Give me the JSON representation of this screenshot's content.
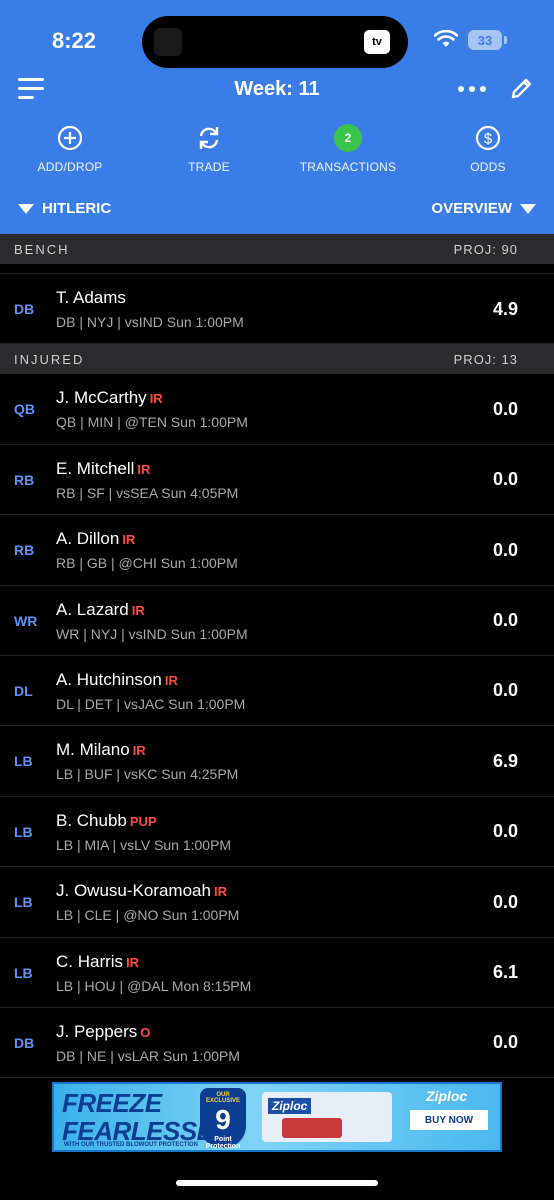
{
  "status": {
    "time": "8:22",
    "battery": "33",
    "island_app": "tv"
  },
  "nav": {
    "title": "Week: 11"
  },
  "actions": [
    {
      "label": "ADD/DROP",
      "icon": "plus-circle-icon"
    },
    {
      "label": "TRADE",
      "icon": "refresh-icon"
    },
    {
      "label": "TRANSACTIONS",
      "badge": "2"
    },
    {
      "label": "ODDS",
      "icon": "dollar-circle-icon"
    }
  ],
  "subnav": {
    "team": "HITLERIC",
    "view": "OVERVIEW"
  },
  "bench": {
    "title": "BENCH",
    "proj": "PROJ: 90",
    "players": [
      {
        "pos": "DB",
        "name": "T. Adams",
        "tag": "",
        "info": "DB | NYJ | vsIND Sun 1:00PM",
        "pts": "4.9"
      }
    ]
  },
  "injured": {
    "title": "INJURED",
    "proj": "PROJ: 13",
    "players": [
      {
        "pos": "QB",
        "name": "J. McCarthy",
        "tag": "IR",
        "info": "QB | MIN | @TEN Sun 1:00PM",
        "pts": "0.0"
      },
      {
        "pos": "RB",
        "name": "E. Mitchell",
        "tag": "IR",
        "info": "RB | SF | vsSEA Sun 4:05PM",
        "pts": "0.0"
      },
      {
        "pos": "RB",
        "name": "A. Dillon",
        "tag": "IR",
        "info": "RB | GB | @CHI Sun 1:00PM",
        "pts": "0.0"
      },
      {
        "pos": "WR",
        "name": "A. Lazard",
        "tag": "IR",
        "info": "WR | NYJ | vsIND Sun 1:00PM",
        "pts": "0.0"
      },
      {
        "pos": "DL",
        "name": "A. Hutchinson",
        "tag": "IR",
        "info": "DL | DET | vsJAC Sun 1:00PM",
        "pts": "0.0"
      },
      {
        "pos": "LB",
        "name": "M. Milano",
        "tag": "IR",
        "info": "LB | BUF | vsKC Sun 4:25PM",
        "pts": "6.9"
      },
      {
        "pos": "LB",
        "name": "B. Chubb",
        "tag": "PUP",
        "info": "LB | MIA | vsLV Sun 1:00PM",
        "pts": "0.0"
      },
      {
        "pos": "LB",
        "name": "J. Owusu-Koramoah",
        "tag": "IR",
        "info": "LB | CLE | @NO Sun 1:00PM",
        "pts": "0.0"
      },
      {
        "pos": "LB",
        "name": "C. Harris",
        "tag": "IR",
        "info": "LB | HOU | @DAL Mon 8:15PM",
        "pts": "6.1"
      },
      {
        "pos": "DB",
        "name": "J. Peppers",
        "tag": "O",
        "info": "DB | NE | vsLAR Sun 1:00PM",
        "pts": "0.0"
      }
    ]
  },
  "ad": {
    "headline1": "FREEZE",
    "headline2": "FEARLESSLY",
    "small": "WITH OUR TRUSTED BLOWOUT PROTECTION",
    "shield_top": "OUR EXCLUSIVE",
    "shield_num": "9",
    "shield_text": "Point Protection",
    "brand": "Ziploc",
    "cta": "BUY NOW"
  }
}
